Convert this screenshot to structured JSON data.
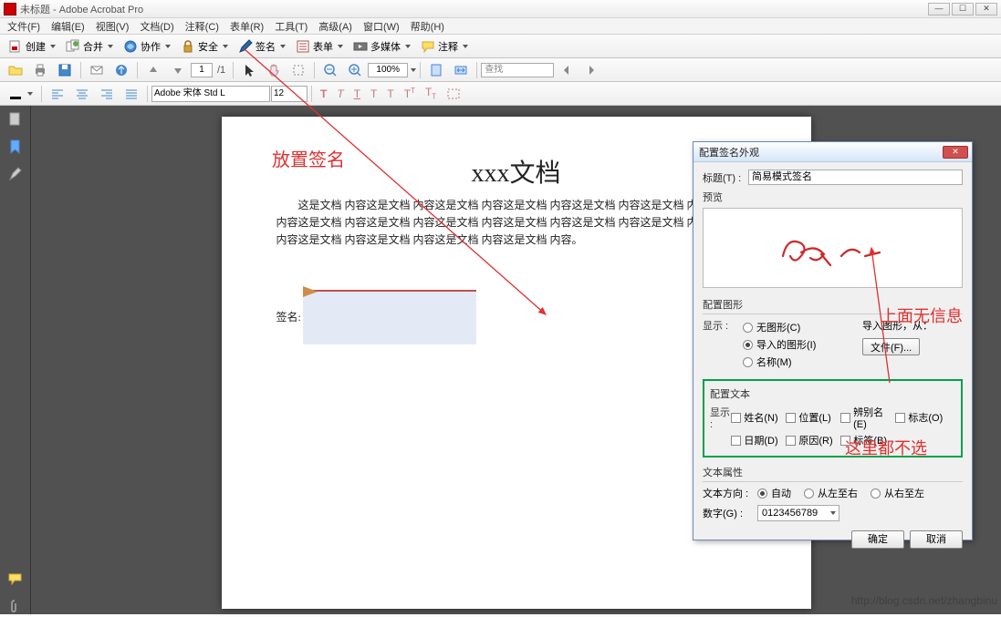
{
  "window": {
    "title": "未标题 - Adobe Acrobat Pro"
  },
  "menu": [
    "文件(F)",
    "编辑(E)",
    "视图(V)",
    "文档(D)",
    "注释(C)",
    "表单(R)",
    "工具(T)",
    "高级(A)",
    "窗口(W)",
    "帮助(H)"
  ],
  "toolbar1": {
    "create": "创建",
    "combine": "合并",
    "collab": "协作",
    "secure": "安全",
    "sign": "签名",
    "form": "表单",
    "media": "多媒体",
    "comment": "注释"
  },
  "nav": {
    "page": "1",
    "total": "/1",
    "zoom": "100%",
    "search_ph": "查找"
  },
  "fontbar": {
    "font": "Adobe 宋体 Std L",
    "size": "12"
  },
  "doc": {
    "title": "xxx文档",
    "body": "这是文档 内容这是文档 内容这是文档 内容这是文档 内容这是文档 内容这是文档 内容这是文档 内容这是文档 内容这是文档 内容这是文档 内容这是文档 内容这是文档 内容这是文档 内容这是文档 内容这是文档 内容这是文档 内容这是文档 内容这是文档 内容。",
    "sig_label": "签名:"
  },
  "dialog": {
    "title": "配置签名外观",
    "title_label": "标题(T) :",
    "title_value": "简易模式签名",
    "preview_label": "预览",
    "graphic_group": "配置图形",
    "show_label": "显示 :",
    "radio_none": "无图形(C)",
    "radio_import": "导入的图形(I)",
    "radio_name": "名称(M)",
    "import_label": "导入图形，从：",
    "file_btn": "文件(F)...",
    "text_group": "配置文本",
    "chk_name": "姓名(N)",
    "chk_loc": "位置(L)",
    "chk_dn": "辨别名(E)",
    "chk_logo": "标志(O)",
    "chk_date": "日期(D)",
    "chk_reason": "原因(R)",
    "chk_tag": "标签(B)",
    "textprop_group": "文本属性",
    "dir_label": "文本方向 :",
    "dir_auto": "自动",
    "dir_ltr": "从左至右",
    "dir_rtl": "从右至左",
    "digits_label": "数字(G) :",
    "digits_value": "0123456789",
    "ok": "确定",
    "cancel": "取消"
  },
  "annotations": {
    "place_sig": "放置签名",
    "no_info": "上面无信息",
    "none_select": "这里都不选"
  },
  "watermark": "http://blog.csdn.net/zhangbinu"
}
